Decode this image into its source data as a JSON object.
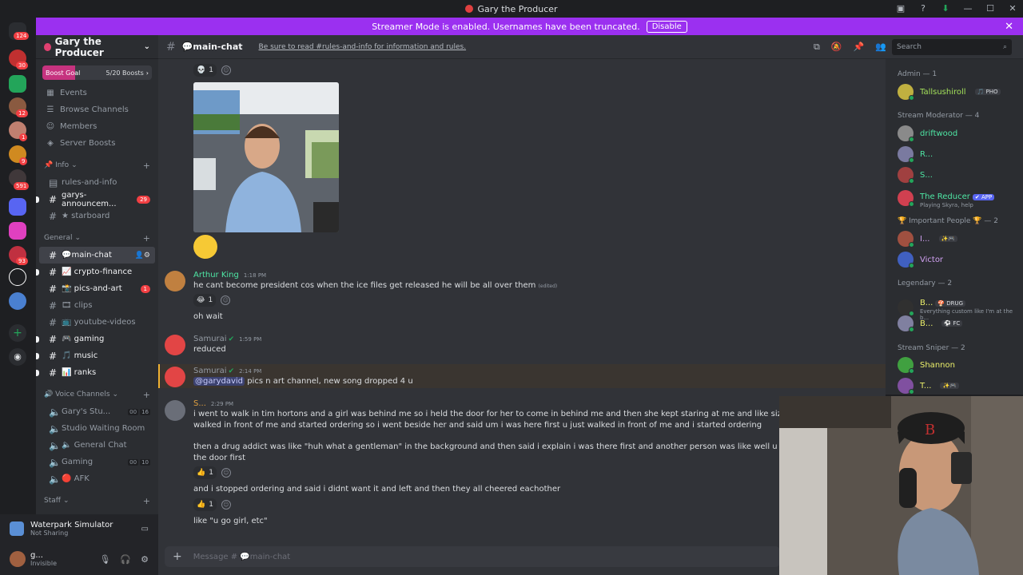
{
  "window": {
    "title": "Gary the Producer"
  },
  "banner": {
    "text": "Streamer Mode is enabled. Usernames have been truncated.",
    "button": "Disable"
  },
  "rail": {
    "badges": [
      "124",
      "30",
      "12",
      "1",
      "9",
      "591",
      "93"
    ]
  },
  "server": {
    "name": "Gary the Producer",
    "boost_label": "Boost Goal",
    "boost_count": "5/20 Boosts",
    "nav": [
      {
        "label": "Events",
        "icon": "calendar-icon"
      },
      {
        "label": "Browse Channels",
        "icon": "browse-icon"
      },
      {
        "label": "Members",
        "icon": "members-icon"
      },
      {
        "label": "Server Boosts",
        "icon": "boost-icon"
      }
    ]
  },
  "channels": {
    "cat_info": "📌 Info",
    "info": [
      {
        "name": "rules-and-info",
        "unread": false
      },
      {
        "name": "garys-announcem...",
        "unread": true,
        "count": "29"
      },
      {
        "name": "★ starboard",
        "unread": false
      }
    ],
    "cat_general": "General",
    "general": [
      {
        "name": "💬main-chat",
        "active": true
      },
      {
        "name": "📈 crypto-finance",
        "unread": true
      },
      {
        "name": "📸 pics-and-art",
        "unread": true,
        "count": "1"
      },
      {
        "name": "🎞 clips",
        "unread": false
      },
      {
        "name": "📺 youtube-videos",
        "unread": false
      },
      {
        "name": "🎮 gaming",
        "unread": true
      },
      {
        "name": "🎵 music",
        "unread": true
      },
      {
        "name": "📊 ranks",
        "unread": true
      }
    ],
    "cat_voice": "🔊 Voice Channels",
    "voice": [
      {
        "name": "Gary's Stu...",
        "a": "00",
        "b": "16"
      },
      {
        "name": "Studio Waiting Room"
      },
      {
        "name": "🔈 General Chat"
      },
      {
        "name": "Gaming",
        "a": "00",
        "b": "10"
      },
      {
        "name": "🔴 AFK"
      }
    ],
    "cat_staff": "Staff"
  },
  "activity": {
    "title": "Waterpark Simulator",
    "sub": "Not Sharing"
  },
  "user": {
    "name": "g...",
    "status": "Invisible"
  },
  "header": {
    "channel": "💬main-chat",
    "topic": "Be sure to read #rules-and-info for information and rules.",
    "search_placeholder": "Search"
  },
  "messages": [
    {
      "id": "top-reaction",
      "count": "1"
    },
    {
      "id": "arthur",
      "author": "Arthur King",
      "time": "1:18 PM",
      "text": "he cant become president cos when the ice files get released he will be all over them",
      "edited": "(edited)",
      "reaction_count": "1"
    },
    {
      "id": "arthur-2",
      "text": "oh wait"
    },
    {
      "id": "samurai-1",
      "author": "Samurai",
      "time": "1:59 PM",
      "text": "reduced"
    },
    {
      "id": "samurai-2",
      "author": "Samurai",
      "time": "2:14 PM",
      "mention": "@garydavid",
      "text": " pics n art channel, new song dropped 4 u"
    },
    {
      "id": "s",
      "author": "S...",
      "time": "2:29 PM",
      "line1": "i went to walk in tim hortons and a girl was behind me so i held the door for her to come in behind me and then she kept staring at me and like sizing me up and when time came",
      "line2": "walked in front of me and started ordering so i went beside her and said um i was here first u just walked in front of me and i started ordering",
      "line3": "then a drug addict was like \"huh  what a gentleman\" in the background and then said i explain i was there first and another person was like well u werent fast enough and another",
      "line4": "the door first",
      "reaction_count": "1",
      "line5": "and i stopped ordering and said  i didnt want it and left and then they all cheered eachother",
      "reaction_count2": "1",
      "line6": "like \"u go girl, etc\""
    }
  ],
  "composer": {
    "placeholder": "Message # 💬main-chat"
  },
  "members": {
    "groups": [
      {
        "title": "Admin — 1",
        "items": [
          {
            "name": "Tallsushiroll",
            "tag": "🎵 PHO",
            "color": "#a3e05a"
          }
        ]
      },
      {
        "title": "Stream Moderator — 4",
        "items": [
          {
            "name": "driftwood",
            "color": "#4ee6a4"
          },
          {
            "name": "R...",
            "color": "#4ee6a4"
          },
          {
            "name": "S...",
            "color": "#4ee6a4"
          },
          {
            "name": "The Reducer",
            "tag": "✔ APP",
            "sub": "Playing Skyra, help",
            "color": "#4ee6a4"
          }
        ]
      },
      {
        "title": "🏆 Important People 🏆 — 2",
        "items": [
          {
            "name": "I...",
            "tag": "✨🎮",
            "color": "#d0a0f0"
          },
          {
            "name": "Victor",
            "color": "#d0a0f0"
          }
        ]
      },
      {
        "title": "Legendary — 2",
        "items": [
          {
            "name": "B...",
            "tag": "🍄 DRUG",
            "sub": "Everything custom like I'm at the b...",
            "color": "#ecf06a"
          },
          {
            "name": "B...",
            "tag": "⚽ FC",
            "color": "#ecf06a"
          }
        ]
      },
      {
        "title": "Stream Sniper — 2",
        "items": [
          {
            "name": "Shannon",
            "color": "#ecf06a"
          },
          {
            "name": "T...",
            "tag": "✨🎮",
            "color": "#ecf06a"
          }
        ]
      }
    ]
  }
}
